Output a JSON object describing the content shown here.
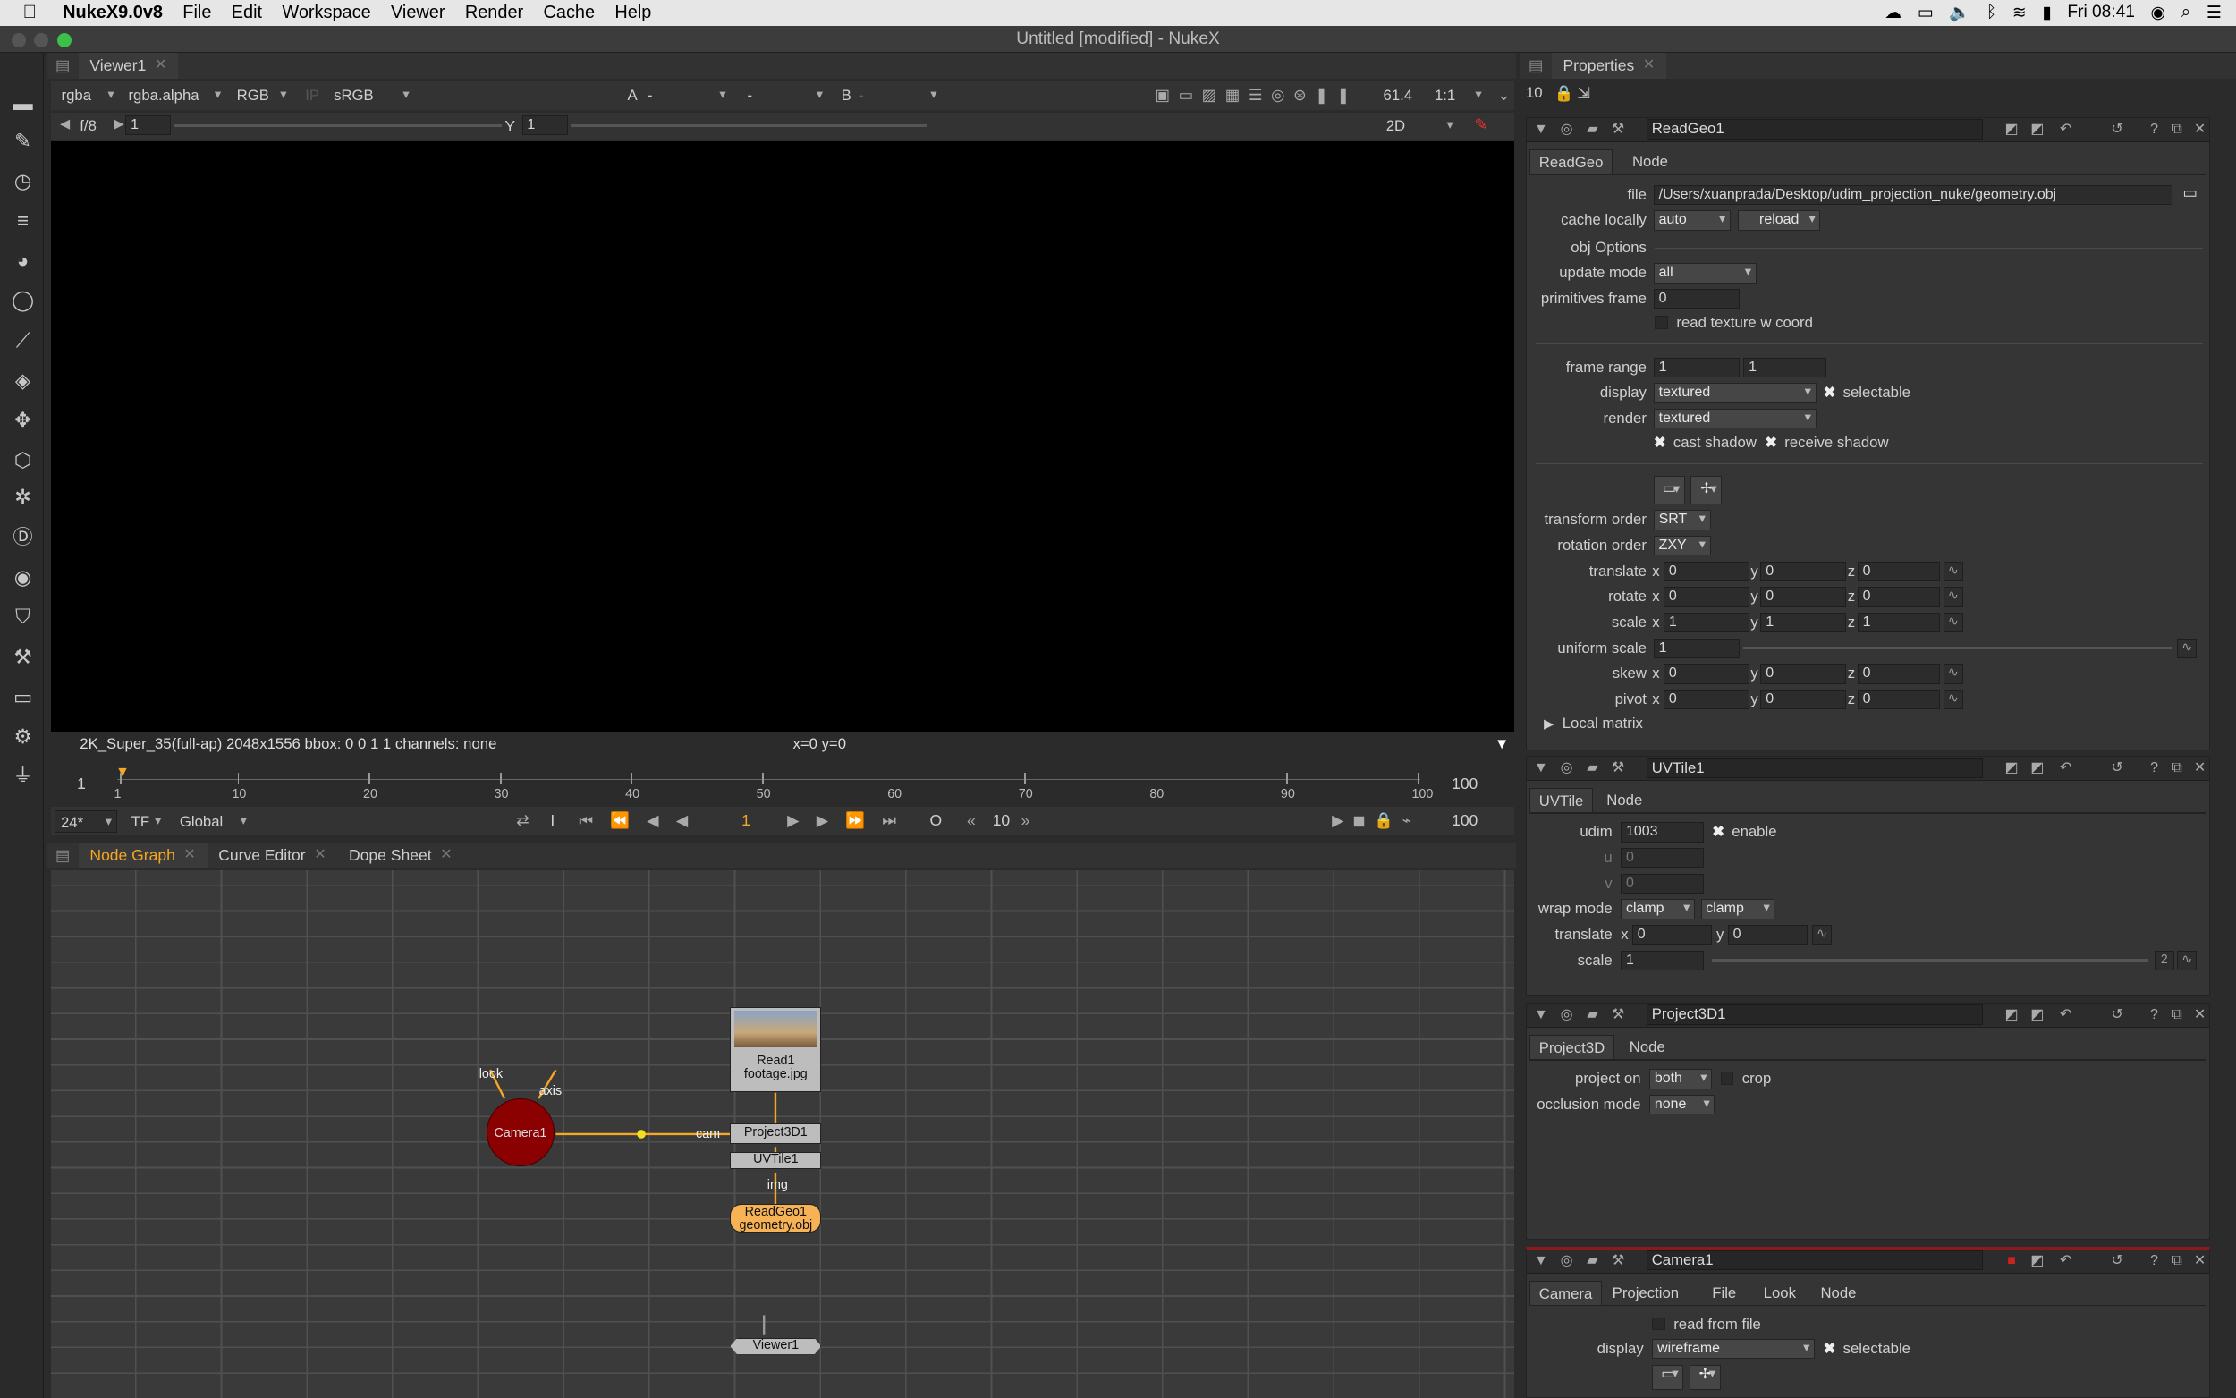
{
  "menubar": {
    "app": "NukeX9.0v8",
    "items": [
      "File",
      "Edit",
      "Workspace",
      "Viewer",
      "Render",
      "Cache",
      "Help"
    ],
    "clock": "Fri 08:41"
  },
  "window": {
    "title": "Untitled [modified] - NukeX"
  },
  "viewer": {
    "tab": "Viewer1",
    "channels": "rgba",
    "alpha": "rgba.alpha",
    "display": "RGB",
    "ip": "IP",
    "colorspace": "sRGB",
    "input_a": "A",
    "input_a_val": "-",
    "input_mid": "-",
    "input_b": "B",
    "input_b_val": "-",
    "zoom": "61.4",
    "ratio": "1:1",
    "fstop": "f/8",
    "gain": "1",
    "gamma_label": "Y",
    "gamma": "1",
    "view_mode": "2D",
    "status": "2K_Super_35(full-ap) 2048x1556  bbox: 0 0 1 1 channels: none",
    "coords": "x=0 y=0"
  },
  "timeline": {
    "start": "1",
    "end": "100",
    "end2": "100",
    "ticks": [
      "1",
      "10",
      "20",
      "30",
      "40",
      "50",
      "60",
      "70",
      "80",
      "90",
      "100"
    ],
    "fps": "24*",
    "tf": "TF",
    "scope": "Global",
    "current_frame": "1",
    "step": "10",
    "in": "I",
    "out": "O"
  },
  "bottom_tabs": [
    "Node Graph",
    "Curve Editor",
    "Dope Sheet"
  ],
  "nodes": {
    "read": {
      "line1": "Read1",
      "line2": "footage.jpg"
    },
    "project": "Project3D1",
    "uvtile": "UVTile1",
    "readgeo": {
      "line1": "ReadGeo1",
      "line2": "geometry.obj"
    },
    "camera": "Camera1",
    "viewer": "Viewer1",
    "labels": {
      "look": "look",
      "axis": "axis",
      "cam": "cam",
      "img": "img"
    }
  },
  "properties": {
    "title": "Properties",
    "max_panels": "10",
    "readgeo": {
      "name": "ReadGeo1",
      "tabs": [
        "ReadGeo",
        "Node"
      ],
      "file_label": "file",
      "file": "/Users/xuanprada/Desktop/udim_projection_nuke/geometry.obj",
      "cache_label": "cache locally",
      "cache": "auto",
      "reload": "reload",
      "obj_options": "obj Options",
      "update_label": "update mode",
      "update": "all",
      "prim_label": "primitives frame",
      "prim": "0",
      "read_tex": "read texture w coord",
      "frame_range_label": "frame range",
      "fr1": "1",
      "fr2": "1",
      "display_label": "display",
      "display": "textured",
      "selectable": "selectable",
      "render_label": "render",
      "render": "textured",
      "cast": "cast shadow",
      "receive": "receive shadow",
      "torder_label": "transform order",
      "torder": "SRT",
      "rorder_label": "rotation order",
      "rorder": "ZXY",
      "translate_label": "translate",
      "rotate_label": "rotate",
      "scale_label": "scale",
      "uscale_label": "uniform scale",
      "skew_label": "skew",
      "pivot_label": "pivot",
      "translate": [
        "0",
        "0",
        "0"
      ],
      "rotate": [
        "0",
        "0",
        "0"
      ],
      "scale": [
        "1",
        "1",
        "1"
      ],
      "uscale": "1",
      "skew": [
        "0",
        "0",
        "0"
      ],
      "pivot": [
        "0",
        "0",
        "0"
      ],
      "local_matrix": "Local matrix",
      "axis_x": "x",
      "axis_y": "y",
      "axis_z": "z"
    },
    "uvtile": {
      "name": "UVTile1",
      "tabs": [
        "UVTile",
        "Node"
      ],
      "udim_label": "udim",
      "udim": "1003",
      "enable": "enable",
      "u_label": "u",
      "u": "0",
      "v_label": "v",
      "v": "0",
      "wrap_label": "wrap mode",
      "wrap1": "clamp",
      "wrap2": "clamp",
      "translate_label": "translate",
      "tx": "0",
      "ty": "0",
      "scale_label": "scale",
      "scale": "1",
      "badge": "2"
    },
    "project3d": {
      "name": "Project3D1",
      "tabs": [
        "Project3D",
        "Node"
      ],
      "project_on_label": "project on",
      "project_on": "both",
      "crop": "crop",
      "occlusion_label": "occlusion mode",
      "occlusion": "none"
    },
    "camera": {
      "name": "Camera1",
      "tabs": [
        "Camera",
        "Projection",
        "File",
        "Look",
        "Node"
      ],
      "read_file": "read from file",
      "display_label": "display",
      "display": "wireframe",
      "selectable": "selectable"
    }
  },
  "colors": {
    "accent_orange": "#f5a623",
    "camera_red": "#8b0000",
    "readgeo_orange": "#f7b255"
  }
}
